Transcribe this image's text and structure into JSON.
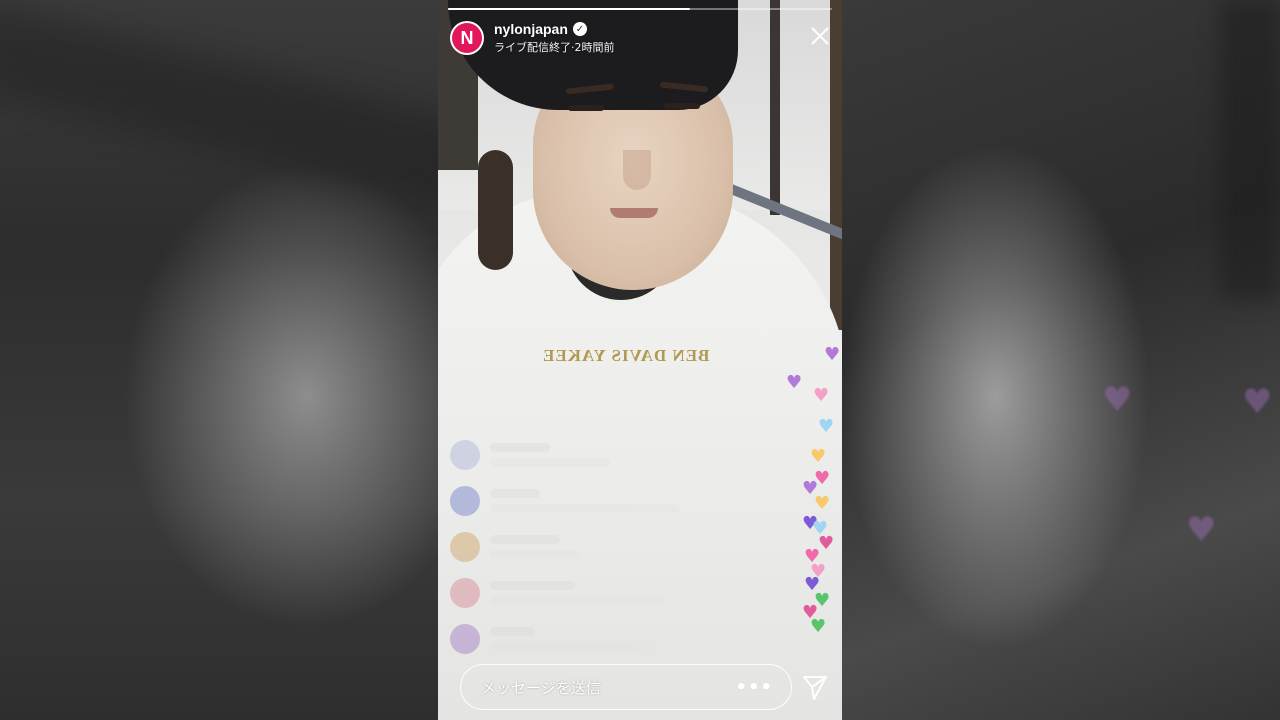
{
  "story": {
    "progress": 0.63,
    "username": "nylonjapan",
    "verified": true,
    "subtitle": "ライブ配信終了·2時間前",
    "avatar_logo": "N",
    "close_icon": "close-icon"
  },
  "scene": {
    "hoodie_print": "BEN DAVIS YAKEE"
  },
  "bottom_bar": {
    "message_placeholder": "メッセージを送信",
    "more_label": "•••",
    "send_icon": "paper-plane-icon"
  },
  "colors": {
    "brand": "#e2165b",
    "hearts": [
      "#b07ad8",
      "#f2a0c8",
      "#f7c96a",
      "#9fd4f2",
      "#f06aa8",
      "#e05c9a",
      "#7c5bd6",
      "#58c46c"
    ]
  }
}
